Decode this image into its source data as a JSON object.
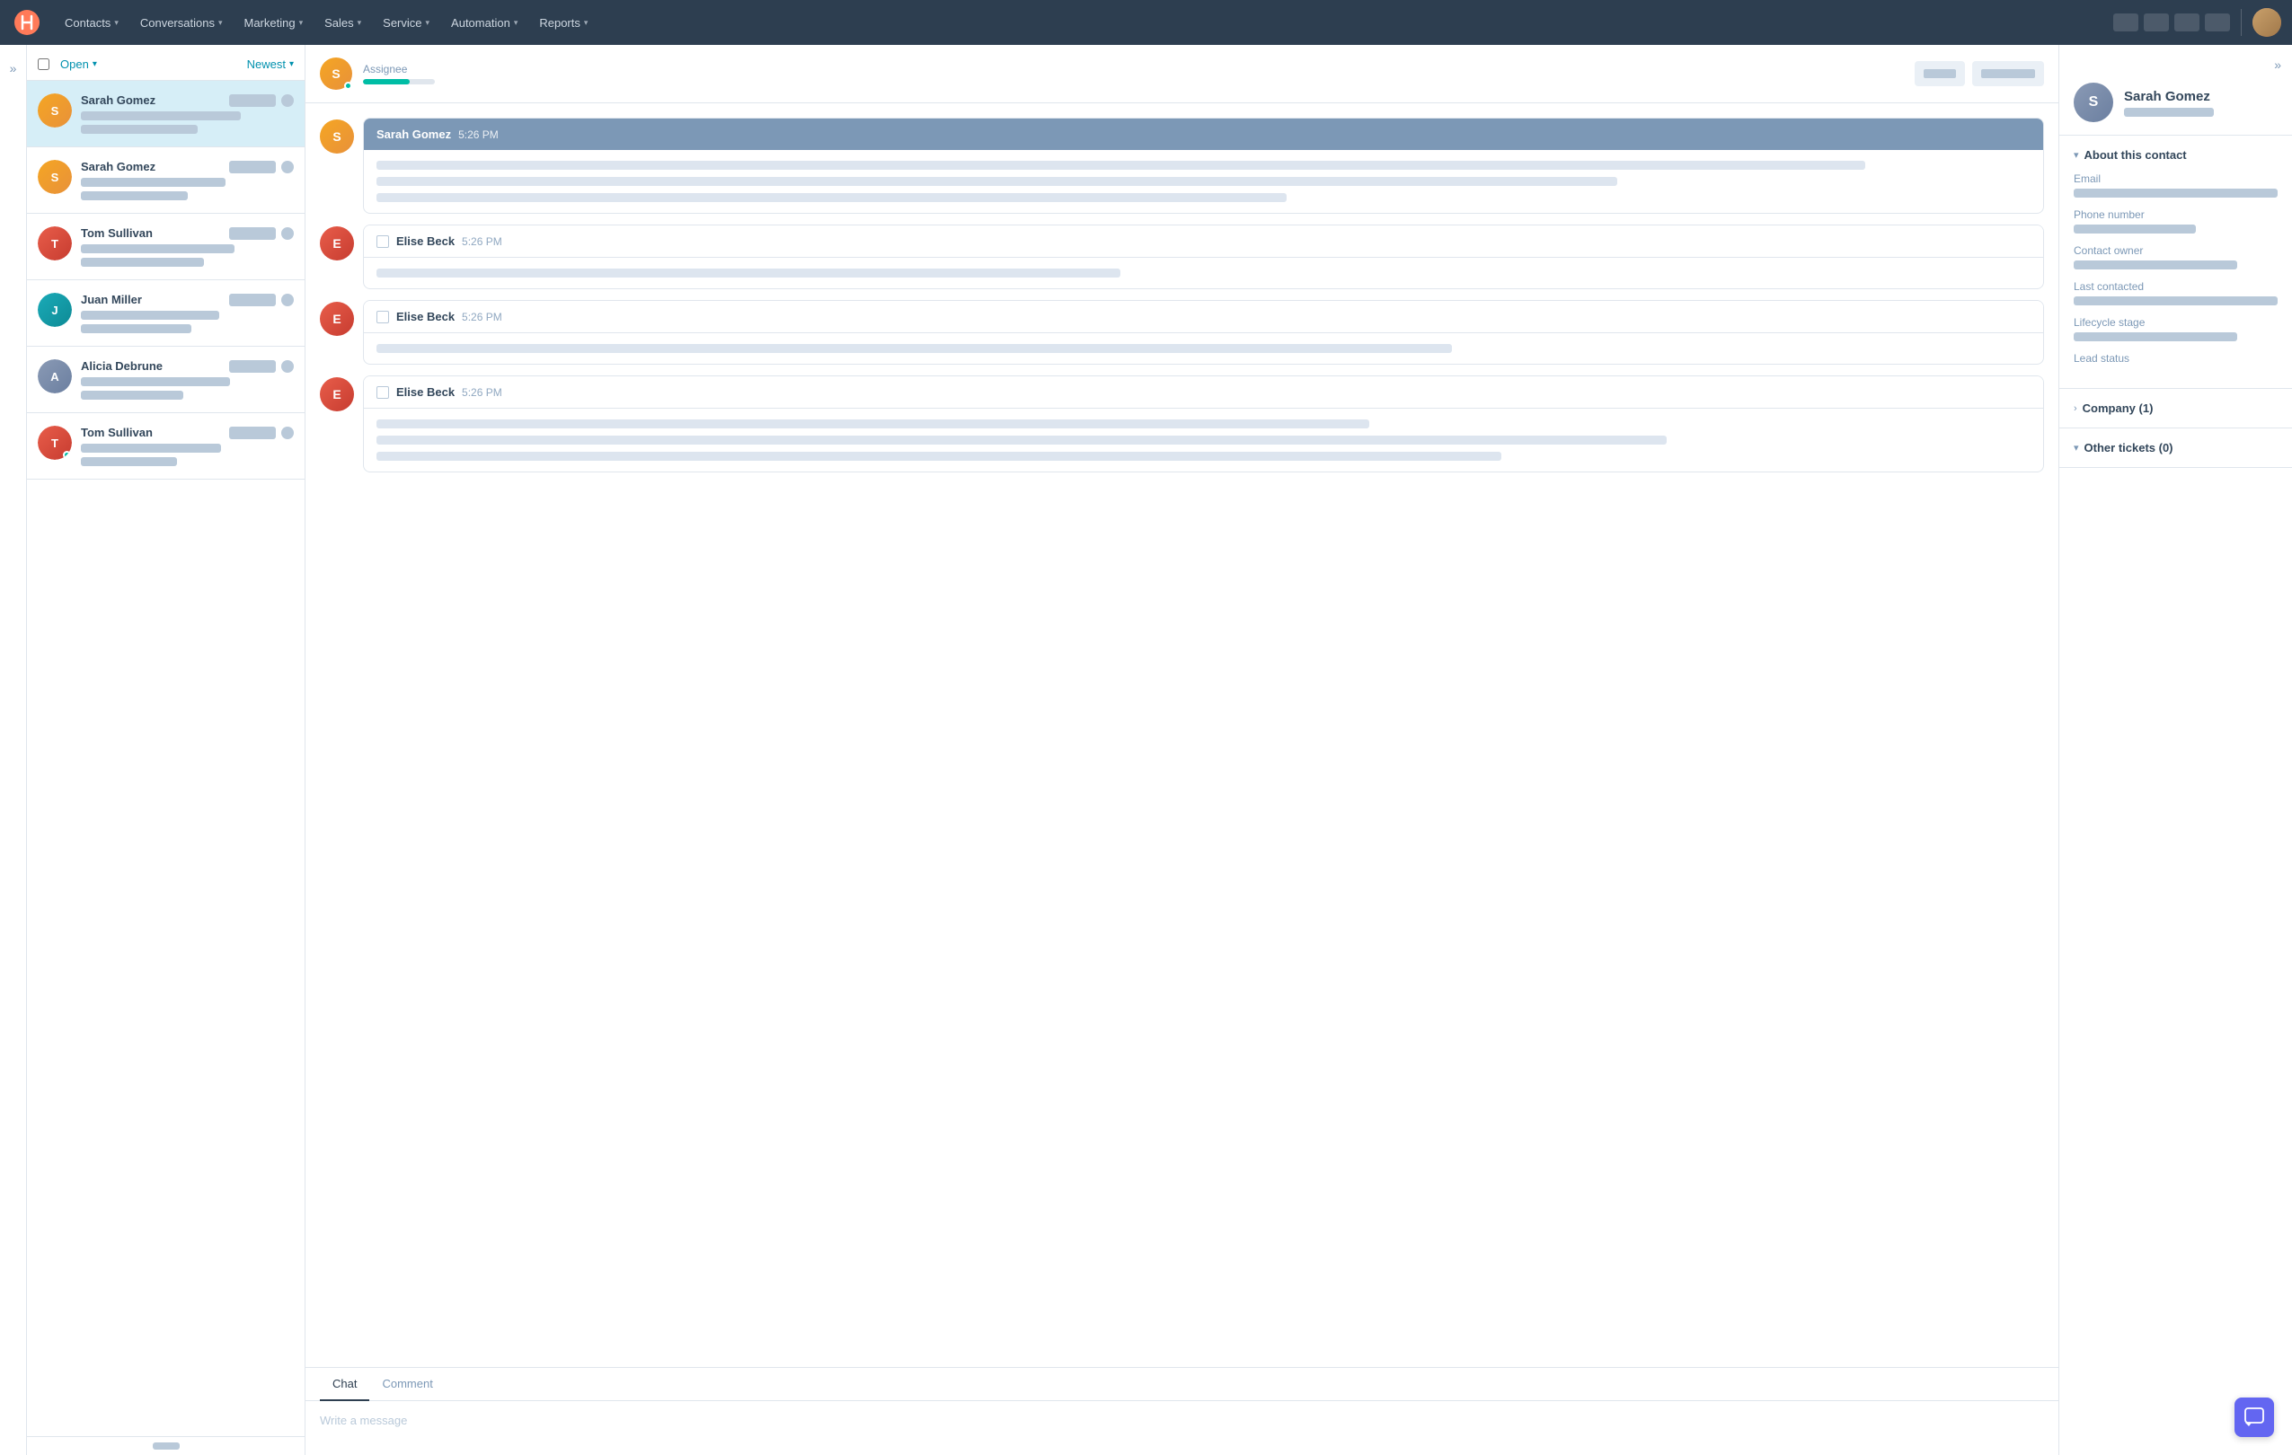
{
  "nav": {
    "logo_label": "HubSpot",
    "items": [
      {
        "label": "Contacts",
        "id": "contacts"
      },
      {
        "label": "Conversations",
        "id": "conversations"
      },
      {
        "label": "Marketing",
        "id": "marketing"
      },
      {
        "label": "Sales",
        "id": "sales"
      },
      {
        "label": "Service",
        "id": "service"
      },
      {
        "label": "Automation",
        "id": "automation"
      },
      {
        "label": "Reports",
        "id": "reports"
      }
    ]
  },
  "conv_list": {
    "filter_open": "Open",
    "filter_newest": "Newest",
    "contacts": [
      {
        "name": "Sarah Gomez",
        "avatar_type": "orange",
        "active": true,
        "online": false
      },
      {
        "name": "Sarah Gomez",
        "avatar_type": "orange",
        "active": false,
        "online": false
      },
      {
        "name": "Tom Sullivan",
        "avatar_type": "red",
        "active": false,
        "online": false
      },
      {
        "name": "Juan Miller",
        "avatar_type": "teal",
        "active": false,
        "online": false
      },
      {
        "name": "Alicia Debrune",
        "avatar_type": "gray",
        "active": false,
        "online": false
      },
      {
        "name": "Tom Sullivan",
        "avatar_type": "red",
        "active": false,
        "online": true
      }
    ]
  },
  "chat": {
    "assignee_label": "Assignee",
    "progress_pct": 65,
    "messages": [
      {
        "sender": "Sarah Gomez",
        "time": "5:26 PM",
        "type": "self",
        "lines": [
          90,
          75,
          55
        ]
      },
      {
        "sender": "Elise Beck",
        "time": "5:26 PM",
        "type": "other",
        "lines": [
          45
        ]
      },
      {
        "sender": "Elise Beck",
        "time": "5:26 PM",
        "type": "other",
        "lines": [
          65
        ]
      },
      {
        "sender": "Elise Beck",
        "time": "5:26 PM",
        "type": "other",
        "lines": [
          60,
          78,
          68
        ]
      }
    ],
    "tabs": [
      {
        "label": "Chat",
        "active": true
      },
      {
        "label": "Comment",
        "active": false
      }
    ],
    "input_placeholder": "Write a message"
  },
  "right_panel": {
    "contact_name": "Sarah Gomez",
    "sections": {
      "about": {
        "title": "About this contact",
        "expanded": true,
        "fields": [
          {
            "label": "Email",
            "value_width": "100"
          },
          {
            "label": "Phone number",
            "value_width": "65"
          },
          {
            "label": "Contact owner",
            "value_width": "75"
          },
          {
            "label": "Last contacted",
            "value_width": "100"
          },
          {
            "label": "Lifecycle stage",
            "value_width": "80"
          },
          {
            "label": "Lead status",
            "value_width": "0"
          }
        ]
      },
      "company": {
        "title": "Company (1)",
        "expanded": false
      },
      "tickets": {
        "title": "Other tickets (0)",
        "expanded": true
      }
    }
  },
  "float_btn": {
    "icon": "▭"
  }
}
